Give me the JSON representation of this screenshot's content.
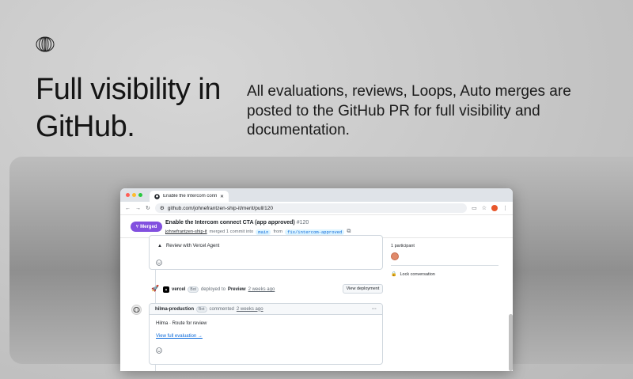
{
  "hero": {
    "headline": "Full visibility in GitHub.",
    "subcopy": "All evaluations, reviews, Loops, Auto merges are posted to the GitHub PR for full visibility and documentation."
  },
  "browser": {
    "tab_title": "Enable the Intercom connect",
    "url": "github.com/johnefrantzen-ship-it/merit/pull/120",
    "profile_initial": "J"
  },
  "pr": {
    "status": "Merged",
    "title": "Enable the Intercom connect CTA (app approved)",
    "number": "#120",
    "author": "johnefrantzen-ship-it",
    "meta_middle": "merged 1 commit into",
    "base_branch": "main",
    "meta_from": "from",
    "head_branch": "fix/intercom-approved"
  },
  "timeline": {
    "review_item": "Review with Vercel Agent",
    "deploy_actor": "vercel",
    "deploy_badge": "Bot",
    "deploy_text": "deployed to",
    "deploy_env": "Preview",
    "deploy_time": "2 weeks ago",
    "view_deployment": "View deployment",
    "comment_author": "hilma-production",
    "comment_badge": "Bot",
    "comment_verb": "commented",
    "comment_time": "2 weeks ago",
    "comment_more": "···",
    "comment_body": "Hilma · Route for review",
    "comment_link": "View full evaluation →"
  },
  "sidebar": {
    "participants": "1 participant",
    "lock": "Lock conversation"
  },
  "colors": {
    "merged": "#8250df",
    "link": "#0969da"
  }
}
